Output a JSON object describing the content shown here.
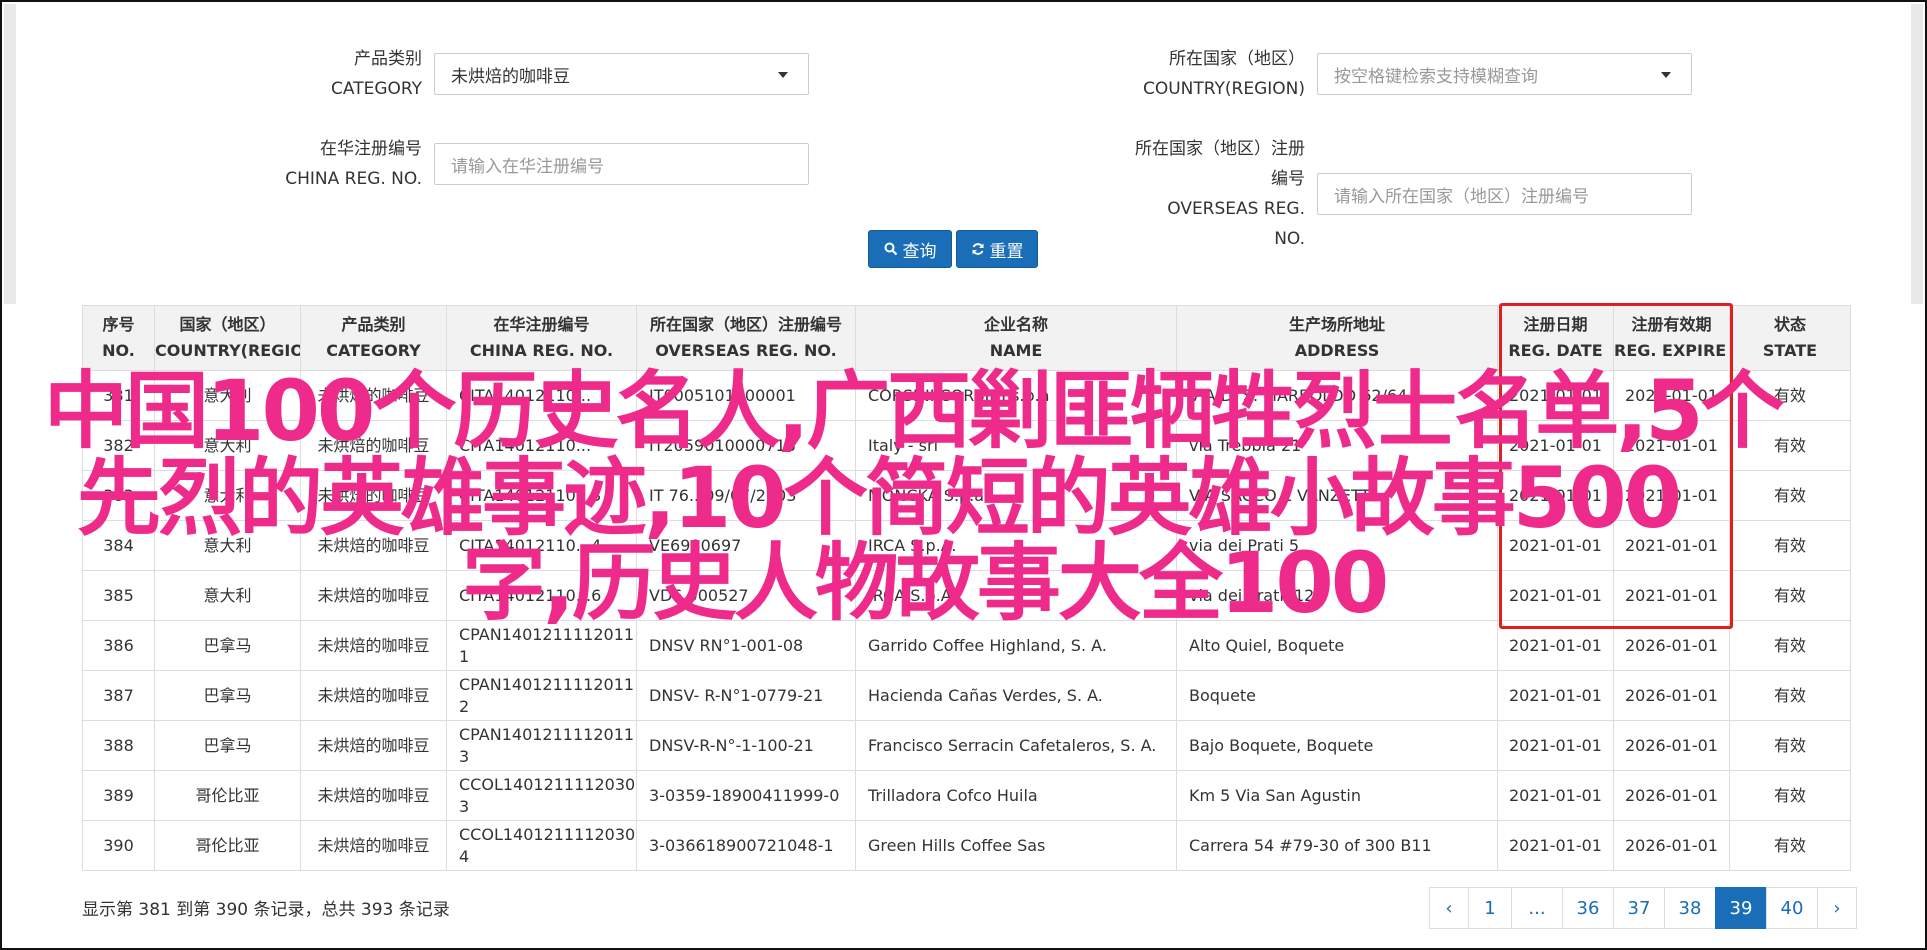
{
  "filters": {
    "category": {
      "label_cn": "产品类别",
      "label_en": "CATEGORY",
      "value": "未烘焙的咖啡豆"
    },
    "country": {
      "label_cn": "所在国家（地区）",
      "label_en": "COUNTRY(REGION)",
      "placeholder": "按空格键检索支持模糊查询"
    },
    "china_reg": {
      "label_cn": "在华注册编号",
      "label_en": "CHINA REG. NO.",
      "placeholder": "请输入在华注册编号"
    },
    "overseas_reg": {
      "label_cn": "所在国家（地区）注册编号",
      "label_en": "OVERSEAS REG. NO.",
      "placeholder": "请输入所在国家（地区）注册编号"
    }
  },
  "buttons": {
    "search": "查询",
    "reset": "重置"
  },
  "columns": [
    {
      "cn": "序号",
      "en": "NO."
    },
    {
      "cn": "国家（地区）",
      "en": "COUNTRY(REGIO..."
    },
    {
      "cn": "产品类别",
      "en": "CATEGORY"
    },
    {
      "cn": "在华注册编号",
      "en": "CHINA REG. NO."
    },
    {
      "cn": "所在国家（地区）注册编号",
      "en": "OVERSEAS REG. NO."
    },
    {
      "cn": "企业名称",
      "en": "NAME"
    },
    {
      "cn": "生产场所地址",
      "en": "ADDRESS"
    },
    {
      "cn": "注册日期",
      "en": "REG. DATE"
    },
    {
      "cn": "注册有效期",
      "en": "REG. EXPIRE ..."
    },
    {
      "cn": "状态",
      "en": "STATE"
    }
  ],
  "rows": [
    {
      "no": "381",
      "country": "意大利",
      "category": "未烘焙的咖啡豆",
      "china_reg": "CITA14012110...",
      "overseas_reg": "IT0005101600001",
      "name": "CORSINI CORSINI s.p.a",
      "address": "VIA DI S. MARBOLDO 62/64",
      "reg_date": "2021-01-01",
      "expire": "2021-01-01",
      "state": "有效"
    },
    {
      "no": "382",
      "country": "意大利",
      "category": "未烘焙的咖啡豆",
      "china_reg": "CITA14012110...",
      "overseas_reg": "IT2059010000718",
      "name": "Italy - srl",
      "address": "via Trebbia 21",
      "reg_date": "2021-01-01",
      "expire": "2021-01-01",
      "state": "有效"
    },
    {
      "no": "383",
      "country": "意大利",
      "category": "未烘焙的咖啡豆",
      "china_reg": "CITA14012110...3",
      "overseas_reg": "IT 76...09/07/2003",
      "name": "MONCKA S.p.a.",
      "address": "VIA SACCO E VANZETTI",
      "reg_date": "2021-01-01",
      "expire": "2021-01-01",
      "state": "有效"
    },
    {
      "no": "384",
      "country": "意大利",
      "category": "未烘焙的咖啡豆",
      "china_reg": "CITA14012110...4",
      "overseas_reg": "VE6900697",
      "name": "IRCA S.p.A.",
      "address": "via dei Prati 5",
      "reg_date": "2021-01-01",
      "expire": "2021-01-01",
      "state": "有效"
    },
    {
      "no": "385",
      "country": "意大利",
      "category": "未烘焙的咖啡豆",
      "china_reg": "CITA14012110...6",
      "overseas_reg": "VD6.000527",
      "name": "IRCA S.p.A.",
      "address": "via dei Prati, 122",
      "reg_date": "2021-01-01",
      "expire": "2021-01-01",
      "state": "有效"
    },
    {
      "no": "386",
      "country": "巴拿马",
      "category": "未烘焙的咖啡豆",
      "china_reg": "CPAN14012111120111",
      "overseas_reg": "DNSV RN°1-001-08",
      "name": "Garrido Coffee Highland, S. A.",
      "address": "Alto Quiel, Boquete",
      "reg_date": "2021-01-01",
      "expire": "2026-01-01",
      "state": "有效"
    },
    {
      "no": "387",
      "country": "巴拿马",
      "category": "未烘焙的咖啡豆",
      "china_reg": "CPAN14012111120112",
      "overseas_reg": "DNSV- R-N°1-0779-21",
      "name": "Hacienda Cañas Verdes, S. A.",
      "address": "Boquete",
      "reg_date": "2021-01-01",
      "expire": "2026-01-01",
      "state": "有效"
    },
    {
      "no": "388",
      "country": "巴拿马",
      "category": "未烘焙的咖啡豆",
      "china_reg": "CPAN14012111120113",
      "overseas_reg": "DNSV-R-N°-1-100-21",
      "name": "Francisco Serracin Cafetaleros, S. A.",
      "address": "Bajo Boquete, Boquete",
      "reg_date": "2021-01-01",
      "expire": "2026-01-01",
      "state": "有效"
    },
    {
      "no": "389",
      "country": "哥伦比亚",
      "category": "未烘焙的咖啡豆",
      "china_reg": "CCOL14012111120303",
      "overseas_reg": "3-0359-18900411999-0",
      "name": "Trilladora Cofco Huila",
      "address": "Km 5 Via San Agustin",
      "reg_date": "2021-01-01",
      "expire": "2026-01-01",
      "state": "有效"
    },
    {
      "no": "390",
      "country": "哥伦比亚",
      "category": "未烘焙的咖啡豆",
      "china_reg": "CCOL14012111120304",
      "overseas_reg": "3-036618900721048-1",
      "name": "Green Hills Coffee Sas",
      "address": "Carrera 54 #79-30 of 300 B11",
      "reg_date": "2021-01-01",
      "expire": "2026-01-01",
      "state": "有效"
    }
  ],
  "overlay": {
    "line1": "中国100个历史名人,广西剿匪牺牲烈士名单,5个",
    "line2": "先烈的英雄事迹,10个简短的英雄小故事500",
    "line3": "字,历史人物故事大全100"
  },
  "footer": {
    "summary": "显示第 381 到第 390 条记录，总共 393 条记录"
  },
  "pagination": {
    "prev": "‹",
    "pages": [
      "1",
      "...",
      "36",
      "37",
      "38",
      "39",
      "40"
    ],
    "active": "39",
    "next": "›"
  },
  "colors": {
    "primary": "#1a6eb8",
    "highlight_box": "#e02020",
    "overlay_text": "#ee2a8a"
  }
}
